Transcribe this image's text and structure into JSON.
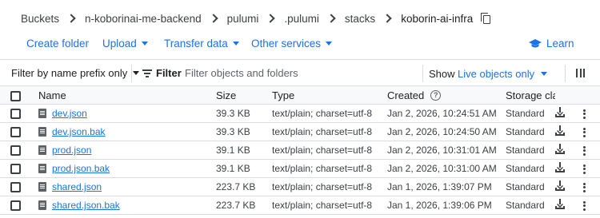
{
  "breadcrumb": {
    "items": [
      "Buckets",
      "n-koborinai-me-backend",
      "pulumi",
      ".pulumi",
      "stacks"
    ],
    "current": "koborin-ai-infra"
  },
  "actions": {
    "create_folder": "Create folder",
    "upload": "Upload",
    "transfer_data": "Transfer data",
    "other_services": "Other services",
    "learn": "Learn"
  },
  "filter_bar": {
    "prefix_label": "Filter by name prefix only",
    "filter_label": "Filter",
    "placeholder": "Filter objects and folders",
    "show_label": "Show",
    "live_objects": "Live objects only"
  },
  "table": {
    "headers": {
      "name": "Name",
      "size": "Size",
      "type": "Type",
      "created": "Created",
      "storage_class": "Storage clas"
    },
    "rows": [
      {
        "name": "dev.json",
        "size": "39.3 KB",
        "type": "text/plain; charset=utf-8",
        "created": "Jan 2, 2026, 10:24:51 AM",
        "storage_class": "Standard"
      },
      {
        "name": "dev.json.bak",
        "size": "39.3 KB",
        "type": "text/plain; charset=utf-8",
        "created": "Jan 2, 2026, 10:24:50 AM",
        "storage_class": "Standard"
      },
      {
        "name": "prod.json",
        "size": "39.1 KB",
        "type": "text/plain; charset=utf-8",
        "created": "Jan 2, 2026, 10:31:01 AM",
        "storage_class": "Standard"
      },
      {
        "name": "prod.json.bak",
        "size": "39.1 KB",
        "type": "text/plain; charset=utf-8",
        "created": "Jan 2, 2026, 10:31:00 AM",
        "storage_class": "Standard"
      },
      {
        "name": "shared.json",
        "size": "223.7 KB",
        "type": "text/plain; charset=utf-8",
        "created": "Jan 1, 2026, 1:39:07 PM",
        "storage_class": "Standard"
      },
      {
        "name": "shared.json.bak",
        "size": "223.7 KB",
        "type": "text/plain; charset=utf-8",
        "created": "Jan 1, 2026, 1:39:06 PM",
        "storage_class": "Standard"
      }
    ]
  },
  "icons": {
    "copy": "copy-icon",
    "learn": "graduation-cap-icon",
    "filter": "filter-icon",
    "columns": "column-display-icon",
    "help": "help-icon",
    "file": "file-icon",
    "download": "download-icon",
    "more": "more-vert-icon"
  },
  "colors": {
    "accent": "#1a73e8",
    "text": "#202124",
    "border": "#dadce0"
  }
}
